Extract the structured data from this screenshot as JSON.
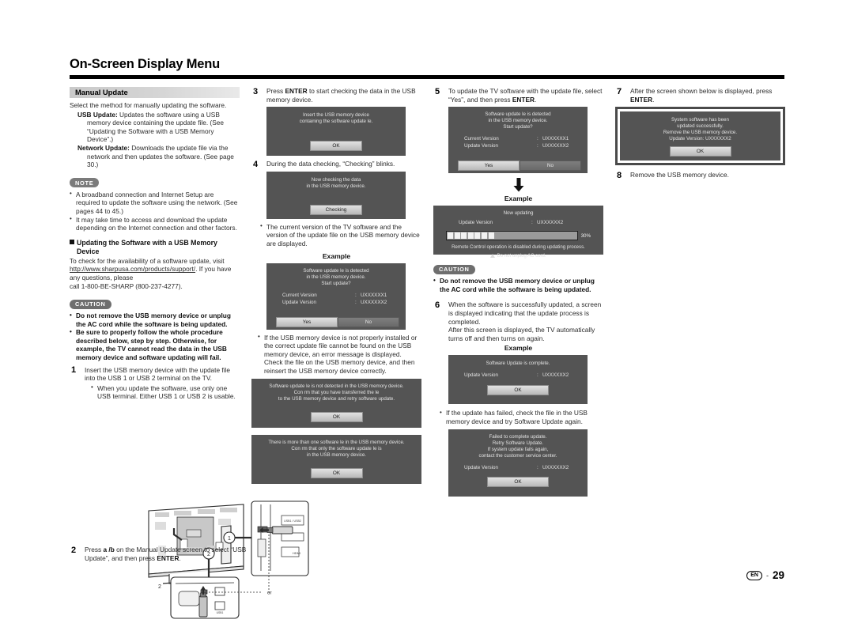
{
  "header": {
    "title": "On-Screen Display Menu"
  },
  "page_footer": {
    "lang_badge": "EN",
    "dash": "-",
    "page_number": "29"
  },
  "col1": {
    "section_title": "Manual Update",
    "intro": "Select the method for manually updating the software.",
    "usb_update_label": "USB Update:",
    "usb_update_body": "Updates the software using a USB memory device containing the update file. (See “Updating the Software with a USB Memory Device”.)",
    "network_update_label": "Network Update:",
    "network_update_body": "Downloads the update file via the network and then updates the software. (See page 30.)",
    "note_badge": "NOTE",
    "notes": [
      "A broadband connection and Internet Setup are required to update the software using the network. (See pages 44 to 45.)",
      "It may take time to access and download the update depending on the Internet connection and other factors."
    ],
    "subhead_line1": "Updating the Software with a USB Memory",
    "subhead_line2": "Device",
    "check_text_1": "To check for the availability of a software update, visit",
    "url": "http://www.sharpusa.com/products/support/",
    "check_text_2": ". If you have any questions, please",
    "check_text_3": "call 1-800-BE-SHARP (800-237-4277).",
    "caution_badge": "CAUTION",
    "cautions": [
      "Do not remove the USB memory device or unplug the AC cord while the software is being updated.",
      "Be sure to properly follow the whole procedure described below, step by step. Otherwise, for example, the TV cannot read the data in the USB memory device and software updating will fail."
    ],
    "step1_num": "1",
    "step1_text": "Insert the USB memory device with the update file into the USB 1 or USB 2 terminal on the TV.",
    "step1_bullet": "When you update the software, use only one USB terminal. Either USB 1 or USB 2 is usable.",
    "illustration_or": "or",
    "illustration_callout1": "1",
    "illustration_callout2": "2",
    "illustration_hdmi": "HDMI",
    "illustration_usb_label": "USB1 / USB2",
    "step2_num": "2",
    "step2_text_a": "Press ",
    "step2_keys": "a /b",
    "step2_text_b": " on the Manual Update screen to select “USB Update”, and then press ",
    "step2_enter": "ENTER",
    "step2_text_c": "."
  },
  "col2": {
    "step3_num": "3",
    "step3_text_a": "Press ",
    "step3_enter": "ENTER",
    "step3_text_b": " to start checking the data in the USB memory device.",
    "dialog_insert": {
      "lines": [
        "Insert the USB memory device",
        "containing the software update  le."
      ],
      "button": "OK"
    },
    "step4_num": "4",
    "step4_text": "During the data checking, “Checking” blinks.",
    "dialog_checking": {
      "lines": [
        "Now checking the data",
        "in the USB memory device."
      ],
      "button": "Checking"
    },
    "bullet_versions": "The current version of the TV software and the version of the update file on the USB memory device are displayed.",
    "example_label": "Example",
    "dialog_detected": {
      "lines": [
        "Software update  le is detected",
        "in the USB memory device.",
        "Start update?"
      ],
      "rows": [
        {
          "key": "Current Version",
          "colon": ":",
          "value": "UXXXXXX1"
        },
        {
          "key": "Update Version",
          "colon": ":",
          "value": "UXXXXXX2"
        }
      ],
      "yes": "Yes",
      "no": "No"
    },
    "bullet_error": "If the USB memory device is not properly installed or the correct update file cannot be found on the USB memory device, an error message is displayed.",
    "bullet_error2": "Check the file on the USB memory device, and then reinsert the USB memory device correctly.",
    "dialog_notdetected": {
      "lines": [
        "Software update  le is not detected in the USB memory device.",
        "Con rm that you have transferred the  le",
        "to the USB memory device and retry software update."
      ],
      "button": "OK"
    },
    "dialog_morethanone": {
      "lines": [
        "There is more than one software  le in the USB memory device.",
        "Con rm that only the software update  le is",
        "in the USB memory device."
      ],
      "button": "OK"
    }
  },
  "col3": {
    "step5_num": "5",
    "step5_text_a": "To update the TV software with the update file, select “Yes”, and then press ",
    "step5_enter": "ENTER",
    "step5_text_b": ".",
    "dialog_confirm": {
      "lines": [
        "Software update  le is detected",
        "in the USB memory device.",
        "Start update?"
      ],
      "rows": [
        {
          "key": "Current Version",
          "colon": ":",
          "value": "UXXXXXX1"
        },
        {
          "key": "Update Version",
          "colon": ":",
          "value": "UXXXXXX2"
        }
      ],
      "yes": "Yes",
      "no": "No"
    },
    "example_label": "Example",
    "dialog_updating": {
      "title": "Now updating",
      "rows": [
        {
          "key": "Update Version",
          "colon": ":",
          "value": "UXXXXXX2"
        }
      ],
      "progress_percent": "30%",
      "progress_segments": 7,
      "note_line": "Remote Control operation is disabled during updating process.",
      "warn_line": "Do not unplug AC cord."
    },
    "caution_badge": "CAUTION",
    "caution_text": "Do not remove the USB memory device or unplug the AC cord while the software is being updated.",
    "step6_num": "6",
    "step6_text": "When the software is successfully updated, a screen is displayed indicating that the update process is completed.",
    "step6_text2": "After this screen is displayed, the TV automatically turns off and then turns on again.",
    "example_label2": "Example",
    "dialog_complete": {
      "lines": [
        "Software Update is complete."
      ],
      "rows": [
        {
          "key": "Update Version",
          "colon": ":",
          "value": "UXXXXXX2"
        }
      ],
      "button": "OK"
    },
    "bullet_failed": "If the update has failed, check the file in the USB memory device and try Software Update again.",
    "dialog_failed": {
      "lines": [
        "Failed to complete update.",
        "Retry Software Update.",
        "If system update fails again,",
        "contact the customer service center."
      ],
      "rows": [
        {
          "key": "Update Version",
          "colon": ":",
          "value": "UXXXXXX2"
        }
      ],
      "button": "OK"
    }
  },
  "col4": {
    "step7_num": "7",
    "step7_text_a": "After the screen shown below is displayed, press ",
    "step7_enter": "ENTER",
    "step7_text_b": ".",
    "dialog_success": {
      "lines": [
        "System software has been",
        "updated successfully.",
        "Remove the USB memory device.",
        "Update Version: UXXXXXX2"
      ],
      "button": "OK"
    },
    "step8_num": "8",
    "step8_text": "Remove the USB memory device."
  }
}
